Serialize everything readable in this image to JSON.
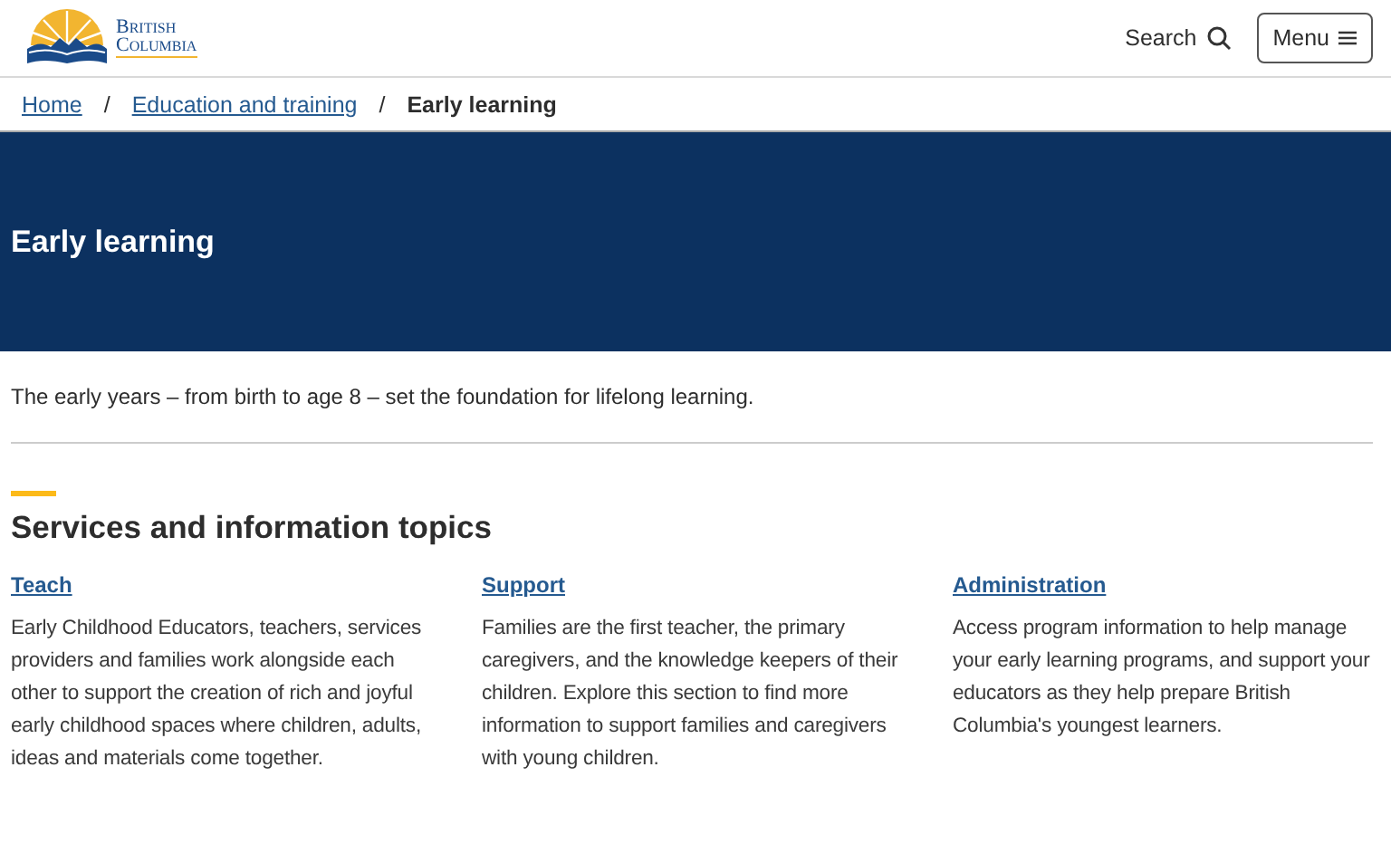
{
  "header": {
    "logo_lines": [
      "British",
      "Columbia"
    ],
    "search": {
      "label": "Search"
    },
    "menu": {
      "label": "Menu"
    }
  },
  "breadcrumb": [
    {
      "label": "Home",
      "current": false
    },
    {
      "label": "Education and training",
      "current": false
    },
    {
      "label": "Early learning",
      "current": true
    }
  ],
  "breadcrumb_separator": "/",
  "banner": {
    "title": "Early learning"
  },
  "intro": "The early years – from birth to age 8 – set the foundation for lifelong learning.",
  "section": {
    "title": "Services and information topics",
    "topics": [
      {
        "title": "Teach",
        "text": "Early Childhood Educators, teachers, services providers and families work alongside each other to support the creation of rich and joyful early childhood spaces where children, adults, ideas and materials come together."
      },
      {
        "title": "Support",
        "text": "Families are the first teacher, the primary caregivers, and the knowledge keepers of their children. Explore this section to find more information to support families and caregivers with young children."
      },
      {
        "title": "Administration",
        "text": "Access program information to help manage your early learning programs, and support your educators as they help prepare British Columbia's youngest learners."
      }
    ]
  }
}
